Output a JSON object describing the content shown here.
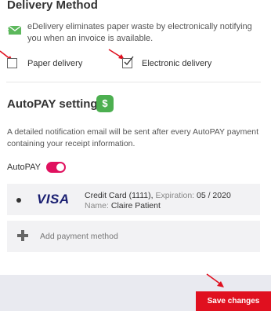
{
  "delivery": {
    "title": "Delivery Method",
    "description": "eDelivery eliminates paper waste by electronically notifying you when an invoice is available.",
    "paper_label": "Paper delivery",
    "paper_checked": false,
    "electronic_label": "Electronic delivery",
    "electronic_checked": true,
    "envelope_icon": "envelope-icon",
    "icon_color": "#5cb85c"
  },
  "autopay": {
    "title": "AutoPAY settings",
    "money_icon": "money-bag-icon",
    "description": "A detailed notification email will be sent after every AutoPAY payment containing your receipt information.",
    "toggle_label": "AutoPAY",
    "toggle_on": true,
    "toggle_color": "#e0115f"
  },
  "payment": {
    "card_brand": "VISA",
    "card_type": "Credit Card (1111),",
    "expiration_label": "Expiration:",
    "expiration_value": "05 / 2020",
    "name_label": "Name:",
    "name_value": "Claire Patient",
    "add_label": "Add payment method"
  },
  "footer": {
    "save_label": "Save changes",
    "save_color": "#e0101f"
  },
  "annotations": {
    "arrow_color": "#e0101f"
  }
}
